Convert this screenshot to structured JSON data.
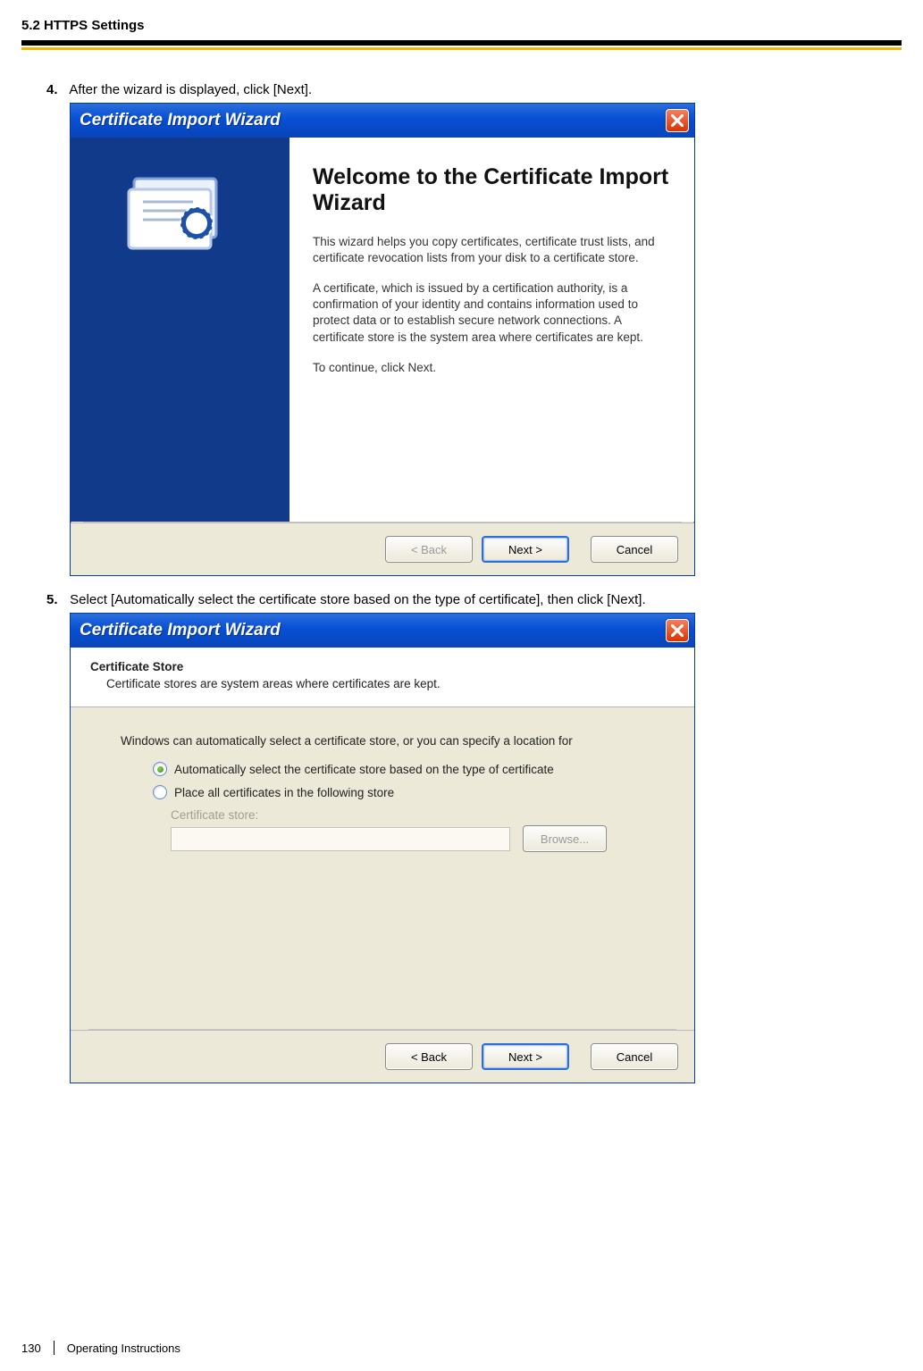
{
  "header": {
    "title": "5.2 HTTPS Settings"
  },
  "steps": {
    "s4": {
      "num": "4.",
      "text": "After the wizard is displayed, click [Next]."
    },
    "s5": {
      "num": "5.",
      "text": "Select [Automatically select the certificate store based on the type of certificate], then click [Next]."
    }
  },
  "wizard1": {
    "title": "Certificate Import Wizard",
    "heading": "Welcome to the Certificate Import Wizard",
    "p1": "This wizard helps you copy certificates, certificate trust lists, and certificate revocation lists from your disk to a certificate store.",
    "p2": "A certificate, which is issued by a certification authority, is a confirmation of your identity and contains information used to protect data or to establish secure network connections. A certificate store is the system area where certificates are kept.",
    "p3": "To continue, click Next.",
    "back": "< Back",
    "next": "Next >",
    "cancel": "Cancel"
  },
  "wizard2": {
    "title": "Certificate Import Wizard",
    "head_title": "Certificate Store",
    "head_sub": "Certificate stores are system areas where certificates are kept.",
    "intro": "Windows can automatically select a certificate store, or you can specify a location for",
    "opt1": "Automatically select the certificate store based on the type of certificate",
    "opt2": "Place all certificates in the following store",
    "store_label": "Certificate store:",
    "browse": "Browse...",
    "back": "< Back",
    "next": "Next >",
    "cancel": "Cancel"
  },
  "footer": {
    "page": "130",
    "doc": "Operating Instructions"
  }
}
